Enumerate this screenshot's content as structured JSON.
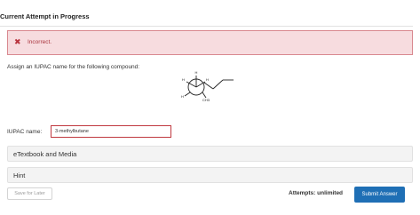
{
  "header": {
    "title": "Current Attempt in Progress"
  },
  "alert": {
    "icon": "close-icon",
    "message": "Incorrect."
  },
  "question": {
    "prompt": "Assign an IUPAC name for the following compound:",
    "structure_labels": {
      "h_top": "H",
      "h_left": "H",
      "h_right": "H",
      "h_bottom_left": "H",
      "ch3": "CH3"
    }
  },
  "answer": {
    "label": "IUPAC name:",
    "value": "3-methylbutane"
  },
  "panels": {
    "ebook": "eTextbook and Media",
    "hint": "Hint"
  },
  "footer": {
    "save_label": "Save for Later",
    "attempts_label": "Attempts: unlimited",
    "submit_label": "Submit Answer"
  },
  "colors": {
    "alert_bg": "#f7dcdf",
    "alert_text": "#a9343d",
    "submit_bg": "#1f6fb5",
    "input_border": "#c0393f"
  }
}
